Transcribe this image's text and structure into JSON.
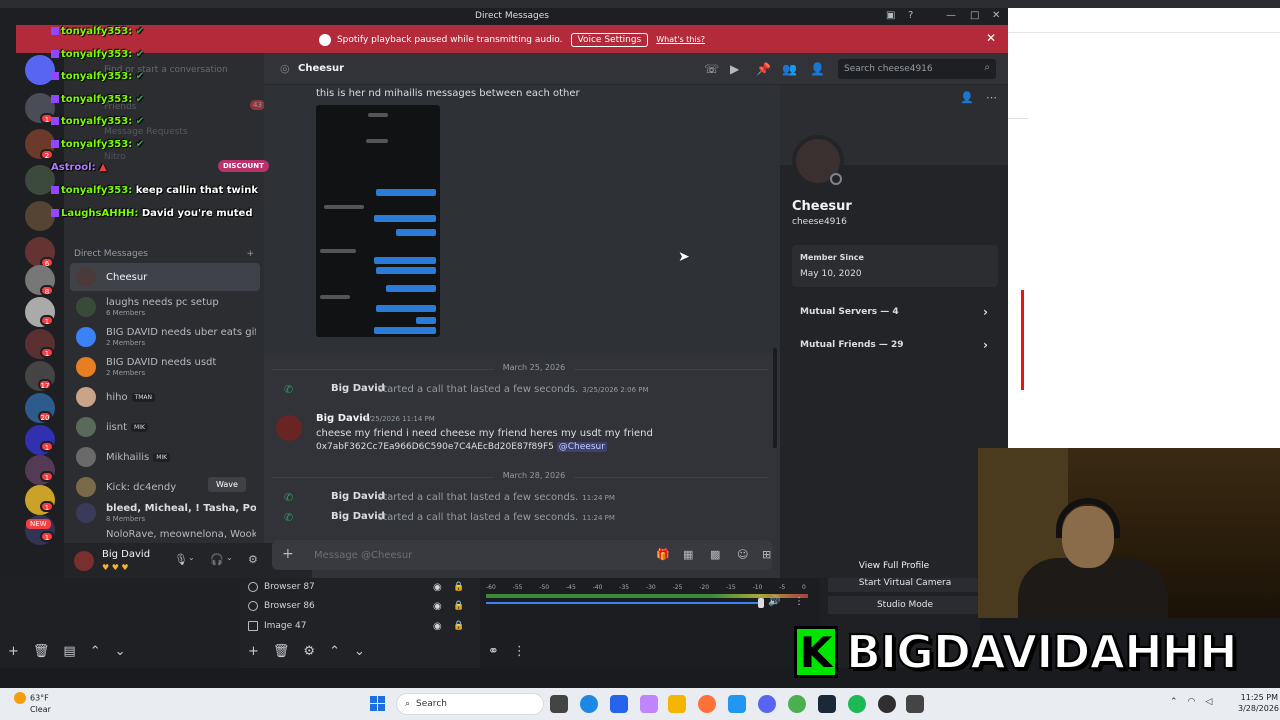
{
  "window": {
    "title": "Direct Messages",
    "banner": {
      "text": "Spotify playback paused while transmitting audio.",
      "button": "Voice Settings",
      "link": "What's this?"
    }
  },
  "stream_chat": [
    {
      "user": "tonyalfy353:",
      "text": ""
    },
    {
      "user": "tonyalfy353:",
      "text": ""
    },
    {
      "user": "tonyalfy353:",
      "text": ""
    },
    {
      "user": "tonyalfy353:",
      "text": ""
    },
    {
      "user": "tonyalfy353:",
      "text": ""
    },
    {
      "user": "tonyalfy353:",
      "text": ""
    },
    {
      "user": "Astrool:",
      "text": ""
    },
    {
      "user": "tonyalfy353:",
      "text": "keep callin that twink"
    },
    {
      "user": "LaughsAHHH:",
      "text": "David you're muted"
    }
  ],
  "discount_badge": "DISCOUNT",
  "dm_faded": {
    "start": "Find or start a conversation",
    "friends": "Friends",
    "requests": "Message Requests",
    "nitro": "Nitro",
    "friends_badge": "43"
  },
  "dm_list": {
    "header": "Direct Messages",
    "add": "+",
    "items": [
      {
        "name": "Cheesur",
        "sub": "",
        "tag": "",
        "active": true
      },
      {
        "name": "laughs needs pc setup",
        "sub": "6 Members",
        "tag": ""
      },
      {
        "name": "BIG DAVID needs uber eats gift...",
        "sub": "2 Members",
        "tag": ""
      },
      {
        "name": "BIG DAVID needs usdt",
        "sub": "2 Members",
        "tag": ""
      },
      {
        "name": "hiho",
        "sub": "",
        "tag": "TMAN"
      },
      {
        "name": "iisnt",
        "sub": "",
        "tag": "MIK"
      },
      {
        "name": "Mikhailis",
        "sub": "",
        "tag": "MIK"
      },
      {
        "name": "Kick: dc4endy",
        "sub": "",
        "tag": ""
      },
      {
        "name": "bleed, Micheal, ! Tasha, Pookie,...",
        "sub": "8 Members",
        "tag": ""
      },
      {
        "name": "NoloRave, meownelona, Wooke...",
        "sub": "",
        "tag": ""
      }
    ],
    "wave": "Wave"
  },
  "guild_badges": [
    "1",
    "2",
    "6",
    "8",
    "1",
    "1",
    "17",
    "20",
    "1",
    "1",
    "1",
    "1",
    "1"
  ],
  "new_label": "NEW",
  "user_panel": {
    "name": "Big David"
  },
  "chat": {
    "channel": "Cheesur",
    "search_placeholder": "Search cheese4916",
    "top_message": "this is her nd mihailis messages between each other",
    "date1": "March 25, 2026",
    "call1": {
      "who": "Big David",
      "text": "started a call that lasted a few seconds.",
      "ts": "3/25/2026 2:06 PM"
    },
    "msg": {
      "who": "Big David",
      "ts": "3/25/2026 11:14 PM",
      "line1": "cheese my friend i need cheese my friend heres my usdt my friend",
      "line2": "0x7abF362Cc7Ea966D6C590e7C4AEcBd20E87f89F5",
      "mention": "@Cheesur"
    },
    "date2": "March 28, 2026",
    "call2": {
      "who": "Big David",
      "text": "started a call that lasted a few seconds.",
      "ts": "11:24 PM"
    },
    "call3": {
      "who": "Big David",
      "text": "started a call that lasted a few seconds.",
      "ts": "11:24 PM"
    },
    "composer_placeholder": "Message @Cheesur"
  },
  "profile": {
    "display_name": "Cheesur",
    "username": "cheese4916",
    "member_since_label": "Member Since",
    "member_since": "May 10, 2020",
    "mutual_servers": "Mutual Servers — 4",
    "mutual_friends": "Mutual Friends — 29",
    "view_full": "View Full Profile"
  },
  "obs": {
    "sources": [
      "Browser 87",
      "Browser 86",
      "Image 47"
    ],
    "mixer_scale": [
      "-60",
      "-55",
      "-50",
      "-45",
      "-40",
      "-35",
      "-30",
      "-25",
      "-20",
      "-15",
      "-10",
      "-5",
      "0"
    ],
    "start_virtual_camera": "Start Virtual Camera",
    "studio_mode": "Studio Mode"
  },
  "overlay_name": "BIGDAVIDAHHH",
  "overlay_logo": "K",
  "taskbar": {
    "temp": "63°F",
    "condition": "Clear",
    "search": "Search",
    "time": "11:25 PM",
    "date": "3/28/2026"
  },
  "colors": {
    "banner": "#b32b3a",
    "accent_green": "#23a55a",
    "overlay_green": "#00e500"
  }
}
